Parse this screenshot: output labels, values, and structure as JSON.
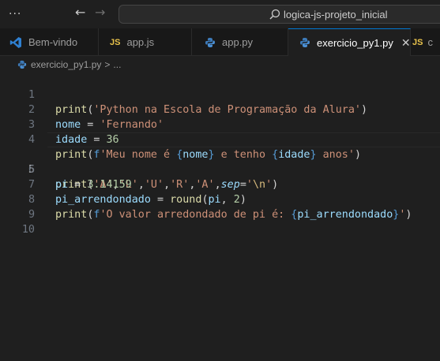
{
  "titlebar": {
    "search_text": "logica-js-projeto_inicial"
  },
  "tabs": [
    {
      "label": "Bem-vindo",
      "icon": "vscode-icon",
      "active": false
    },
    {
      "label": "app.js",
      "icon": "js-icon",
      "active": false
    },
    {
      "label": "app.py",
      "icon": "python-icon",
      "active": false
    },
    {
      "label": "exercicio_py1.py",
      "icon": "python-icon",
      "active": true
    },
    {
      "label": "c",
      "icon": "js-icon",
      "active": false
    }
  ],
  "js_badge": "JS",
  "close_glyph": "✕",
  "breadcrumb": {
    "file": "exercicio_py1.py",
    "separator": ">",
    "more": "..."
  },
  "editor": {
    "current_line": 5,
    "line_numbers": [
      "1",
      "2",
      "3",
      "4",
      "5",
      "6",
      "7",
      "8",
      "9",
      "10"
    ],
    "lines": [
      "print('Python na Escola de Programação da Alura')",
      "nome = 'Fernando'",
      "idade = 36",
      "print(f'Meu nome é {nome} e tenho {idade} anos')",
      "print('A','L','U','R','A',sep='\\n')",
      "pi = 3.14159",
      "pi_arrendondado = round(pi, 2)",
      "print(f'O valor arredondado de pi é: {pi_arrendondado}')",
      "",
      ""
    ]
  },
  "colors": {
    "function": "#dcdcaa",
    "string": "#ce9178",
    "number": "#b5cea8",
    "variable": "#9cdcfe",
    "keyword_param": "#9cdcfe",
    "escape": "#d7ba7d",
    "accent": "#0078d4"
  }
}
